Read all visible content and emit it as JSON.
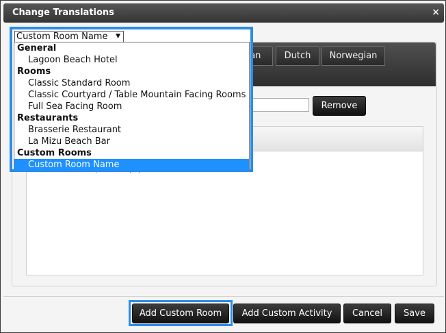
{
  "window": {
    "title": "Change Translations",
    "close_glyph": "×"
  },
  "tabs": [
    {
      "label": "ian"
    },
    {
      "label": "Dutch"
    },
    {
      "label": "Norwegian"
    }
  ],
  "remove_label": "Remove",
  "editor": {
    "placeholder_text": "Custom room description will display here"
  },
  "dropdown": {
    "selected": "Custom Room Name",
    "arrow": "▼",
    "groups": [
      {
        "label": "General",
        "options": [
          "Lagoon Beach Hotel"
        ]
      },
      {
        "label": "Rooms",
        "options": [
          "Classic Standard Room",
          "Classic Courtyard / Table Mountain Facing Rooms",
          "Full Sea Facing Room"
        ]
      },
      {
        "label": "Restaurants",
        "options": [
          "Brasserie Restaurant",
          "La Mizu Beach Bar"
        ]
      },
      {
        "label": "Custom Rooms",
        "options": [
          "Custom Room Name"
        ]
      }
    ]
  },
  "footer": {
    "add_custom_room": "Add Custom Room",
    "add_custom_activity": "Add Custom Activity",
    "cancel": "Cancel",
    "save": "Save"
  },
  "colors": {
    "highlight": "#2b8ce8",
    "selected_option": "#1e90ff"
  }
}
